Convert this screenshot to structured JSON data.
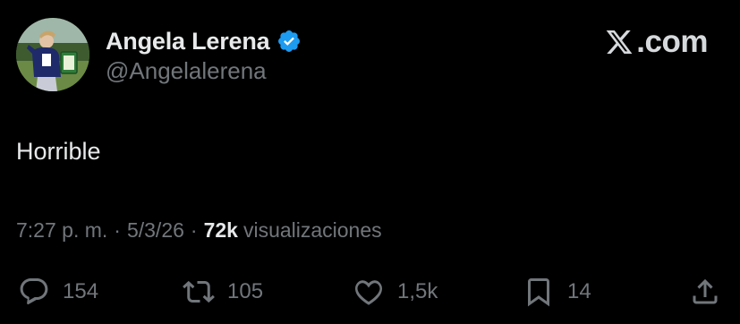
{
  "author": {
    "display_name": "Angela Lerena",
    "handle": "@Angelalerena",
    "verified": true,
    "verified_color": "#1d9bf0"
  },
  "brand": {
    "text": ".com",
    "icon": "x-logo-icon"
  },
  "tweet": {
    "text": "Horrible"
  },
  "meta": {
    "time": "7:27 p. m.",
    "separator": "·",
    "date": "5/3/26",
    "views_count": "72k",
    "views_label": "visualizaciones"
  },
  "actions": {
    "replies": {
      "icon": "reply-icon",
      "count": "154"
    },
    "reposts": {
      "icon": "repost-icon",
      "count": "105"
    },
    "likes": {
      "icon": "heart-icon",
      "count": "1,5k"
    },
    "bookmarks": {
      "icon": "bookmark-icon",
      "count": "14"
    },
    "share": {
      "icon": "share-icon"
    }
  },
  "colors": {
    "background": "#000000",
    "primary_text": "#e7e9ea",
    "secondary_text": "#71767b"
  }
}
